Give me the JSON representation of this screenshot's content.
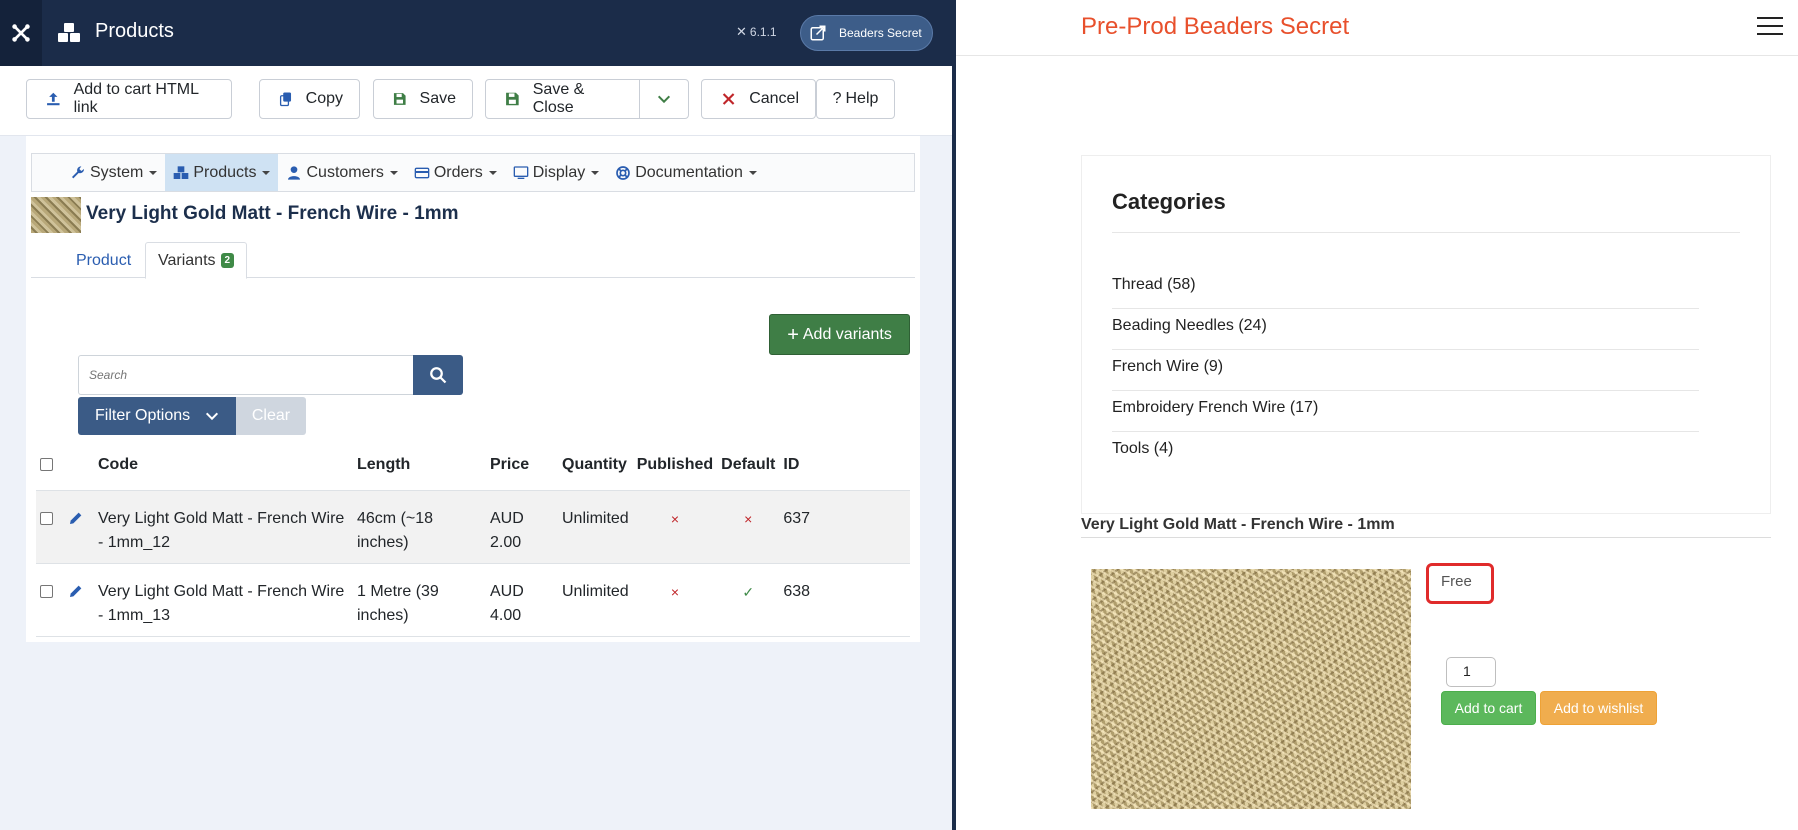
{
  "admin": {
    "header": {
      "title": "Products",
      "version": "6.1.1",
      "site_button": "Beaders Secret"
    },
    "toolbar": {
      "add_to_cart": "Add to cart HTML link",
      "copy": "Copy",
      "save": "Save",
      "save_close": "Save & Close",
      "cancel": "Cancel",
      "help": "Help"
    },
    "menu": {
      "system": "System",
      "products": "Products",
      "customers": "Customers",
      "orders": "Orders",
      "display": "Display",
      "documentation": "Documentation"
    },
    "product_title": "Very Light Gold Matt - French Wire - 1mm",
    "tabs": {
      "product": "Product",
      "variants": "Variants",
      "variants_count": "2"
    },
    "add_variants": "Add variants",
    "search": {
      "placeholder": "Search"
    },
    "filter_options": "Filter Options",
    "clear": "Clear",
    "table": {
      "headers": {
        "code": "Code",
        "length": "Length",
        "price": "Price",
        "quantity": "Quantity",
        "published": "Published",
        "default": "Default",
        "id": "ID"
      },
      "rows": [
        {
          "code": "Very Light Gold Matt - French Wire - 1mm_12",
          "length": "46cm (~18 inches)",
          "price": "AUD 2.00",
          "quantity": "Unlimited",
          "published": "×",
          "default": "×",
          "id": "637"
        },
        {
          "code": "Very Light Gold Matt - French Wire - 1mm_13",
          "length": "1 Metre (39 inches)",
          "price": "AUD 4.00",
          "quantity": "Unlimited",
          "published": "×",
          "default": "✓",
          "id": "638"
        }
      ]
    }
  },
  "site": {
    "title": "Pre-Prod Beaders Secret",
    "categories_title": "Categories",
    "categories": [
      "Thread (58)",
      "Beading Needles (24)",
      "French Wire (9)",
      "Embroidery French Wire (17)",
      "Tools (4)"
    ],
    "product_title": "Very Light Gold Matt - French Wire - 1mm",
    "price": "Free",
    "quantity": "1",
    "add_to_cart": "Add to cart",
    "add_to_wishlist": "Add to wishlist"
  },
  "colors": {
    "admin_header": "#1b2c49",
    "site_title": "#e8502c",
    "add_variants": "#3f7e46",
    "primary_button": "#3b5b86",
    "cart_button": "#5cb85c",
    "wishlist_button": "#f0ad4e",
    "price_highlight": "#e02b2b"
  }
}
